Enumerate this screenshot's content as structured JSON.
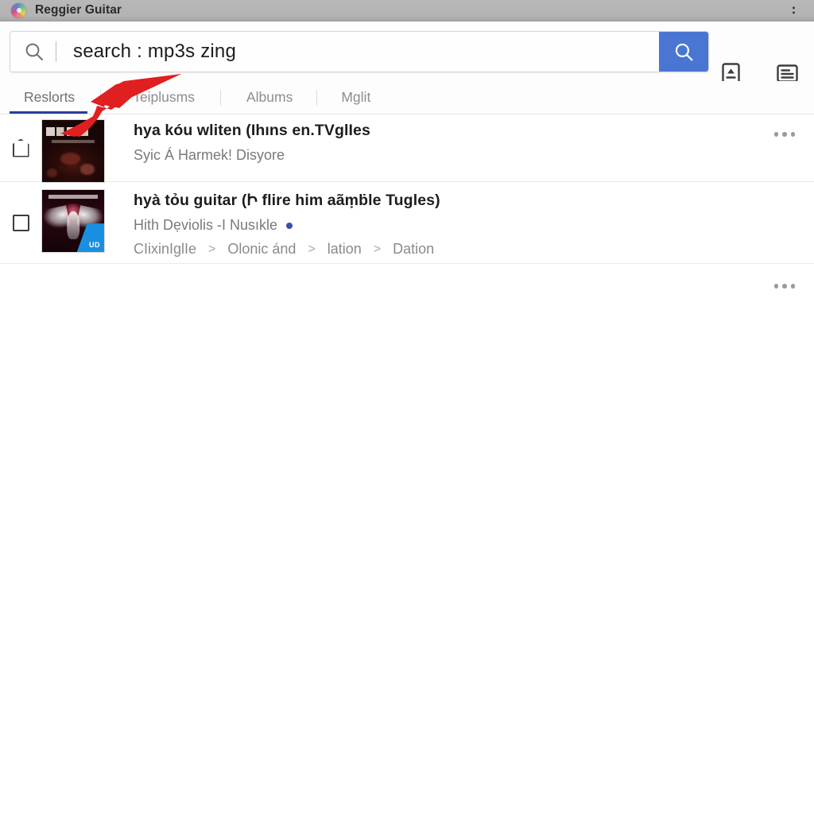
{
  "window": {
    "title": "Reggier Guitar",
    "icon": "music-disc-icon",
    "menu_icon": "more-vertical-icon"
  },
  "search": {
    "icon": "search-icon",
    "value": "search : mp3s zing",
    "placeholder": "search",
    "submit_icon": "search-icon",
    "submit_color": "#4a76d3",
    "actions": [
      {
        "name": "upload-card-icon",
        "label": "upload"
      },
      {
        "name": "list-card-icon",
        "label": "list"
      }
    ]
  },
  "tabs": {
    "items": [
      {
        "label": "Reslorts",
        "active": true
      },
      {
        "label": "Teiplusms",
        "active": false
      },
      {
        "label": "Albums",
        "active": false
      },
      {
        "label": "Mglit",
        "active": false
      }
    ],
    "active_underline_color": "#28409a"
  },
  "results": [
    {
      "select_shape": "pentagon",
      "thumbnail": "dark-album-art",
      "title": "hya kóu wliten (Ihıns en.TVglIes",
      "subtitle": "Syic Á Harmek! Disyore",
      "more_icon": "more-horizontal-icon"
    },
    {
      "select_shape": "square",
      "thumbnail": "winged-figure-album-art",
      "thumbnail_badge": "UD",
      "title": "hyà tỏu guitar (Ի flire him aãṃḃle Tugles)",
      "subtitle": "Hith Dẹviolis -I Nusıkle",
      "subtitle_dot_color": "#3a50a8",
      "breadcrumbs": [
        "CIixinIglIe",
        "Olonic ánd",
        "lation",
        "Dation"
      ],
      "breadcrumb_separator": ">",
      "more_icon": "more-horizontal-icon"
    }
  ],
  "annotation": {
    "type": "arrow",
    "color": "#e02020",
    "points_to": "tab-hidden-between-reslorts-and-teiplusms"
  }
}
